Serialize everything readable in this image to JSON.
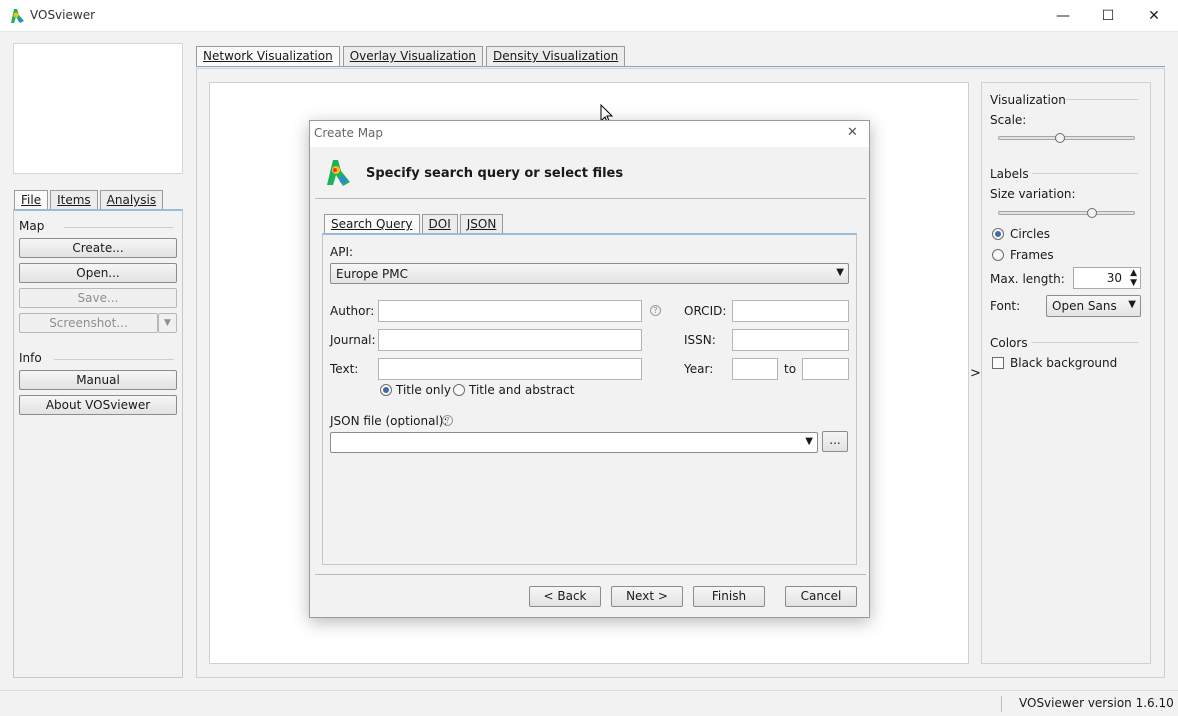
{
  "window": {
    "title": "VOSviewer",
    "minimize": "—",
    "maximize": "☐",
    "close": "✕"
  },
  "left_panel": {
    "tabs": [
      "File",
      "Items",
      "Analysis"
    ],
    "map_section": "Map",
    "buttons": {
      "create": "Create...",
      "open": "Open...",
      "save": "Save...",
      "screenshot": "Screenshot..."
    },
    "info_section": "Info",
    "info_buttons": {
      "manual": "Manual",
      "about": "About VOSviewer"
    }
  },
  "center_tabs": [
    "Network Visualization",
    "Overlay Visualization",
    "Density Visualization"
  ],
  "right_panel": {
    "visualization_label": "Visualization",
    "scale_label": "Scale:",
    "scale_value": 0.45,
    "labels_label": "Labels",
    "size_variation_label": "Size variation:",
    "size_variation_value": 0.7,
    "circles_label": "Circles",
    "frames_label": "Frames",
    "shape_selected": "circles",
    "max_length_label": "Max. length:",
    "max_length_value": "30",
    "font_label": "Font:",
    "font_value": "Open Sans",
    "colors_label": "Colors",
    "black_background_label": "Black background",
    "black_background_checked": false,
    "toggle_arrow": ">"
  },
  "status_bar": {
    "version": "VOSviewer version 1.6.10"
  },
  "dialog": {
    "title": "Create Map",
    "close": "✕",
    "heading": "Specify search query or select files",
    "tabs": [
      "Search Query",
      "DOI",
      "JSON"
    ],
    "api_label": "API:",
    "api_value": "Europe PMC",
    "author_label": "Author:",
    "author_value": "",
    "orcid_label": "ORCID:",
    "orcid_value": "",
    "journal_label": "Journal:",
    "journal_value": "",
    "issn_label": "ISSN:",
    "issn_value": "",
    "text_label": "Text:",
    "text_value": "",
    "year_label": "Year:",
    "year_from": "",
    "year_to_label": "to",
    "year_to": "",
    "title_only_label": "Title only",
    "title_abstract_label": "Title and abstract",
    "text_scope_selected": "title_only",
    "json_file_label": "JSON file (optional):",
    "json_file_value": "",
    "browse_label": "...",
    "help_glyph": "?",
    "buttons": {
      "back": "< Back",
      "next": "Next >",
      "finish": "Finish",
      "cancel": "Cancel"
    }
  },
  "colors": {
    "accent": "#3c6ea5",
    "tab_underline": "#8aa5c0"
  }
}
